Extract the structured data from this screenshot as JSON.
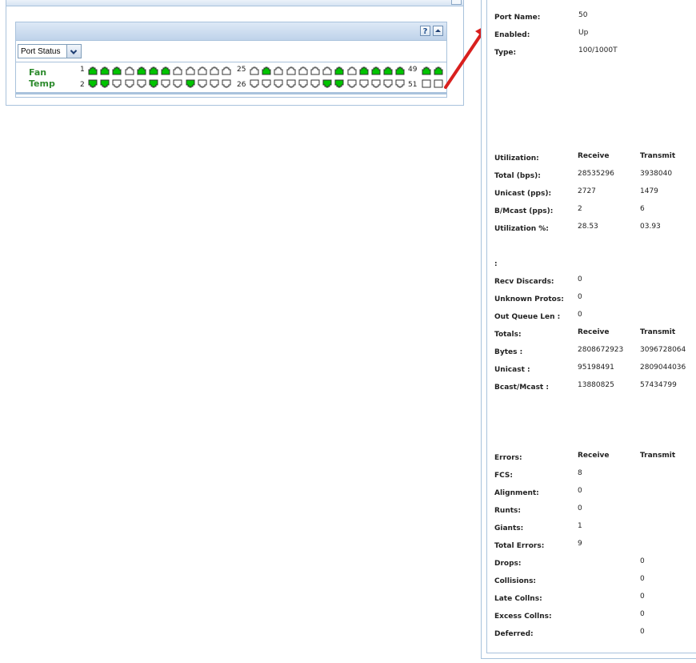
{
  "switch_panel": {
    "view_select": {
      "value": "Port Status"
    },
    "help_button": "?",
    "env_labels": {
      "fan": "Fan",
      "temp": "Temp"
    },
    "port_group_labels": {
      "top_1": "1",
      "bottom_1": "2",
      "top_2": "25",
      "bottom_2": "26",
      "top_3": "49",
      "bottom_3": "51"
    },
    "port_status": {
      "top_row": [
        "up",
        "up",
        "up",
        "down",
        "up",
        "up",
        "up",
        "down",
        "down",
        "down",
        "down",
        "down",
        "down",
        "up",
        "down",
        "down",
        "down",
        "down",
        "down",
        "up",
        "down",
        "up",
        "up",
        "up",
        "up"
      ],
      "bottom_row": [
        "up",
        "up",
        "down",
        "down",
        "down",
        "up",
        "down",
        "down",
        "up",
        "down",
        "down",
        "down",
        "down",
        "down",
        "down",
        "down",
        "down",
        "down",
        "up",
        "up",
        "down",
        "down",
        "down",
        "down",
        "down"
      ],
      "uplink_top": [
        "up",
        "up"
      ],
      "uplink_bottom": [
        "empty",
        "empty"
      ]
    },
    "colors": {
      "port_up": "#00c400",
      "port_down": "#ffffff",
      "env_text": "#2e8b2e"
    }
  },
  "arrow": {
    "color": "#d9201e"
  },
  "details": {
    "port_name": {
      "label": "Port Name:",
      "value": "50"
    },
    "enabled": {
      "label": "Enabled:",
      "value": "Up"
    },
    "type": {
      "label": "Type:",
      "value": "100/1000T"
    },
    "utilization_section": {
      "label": "Utilization:",
      "receive_header": "Receive",
      "transmit_header": "Transmit",
      "rows": [
        {
          "label": "Total (bps):",
          "receive": "28535296",
          "transmit": "3938040"
        },
        {
          "label": "Unicast (pps):",
          "receive": "2727",
          "transmit": "1479"
        },
        {
          "label": "B/Mcast (pps):",
          "receive": "2",
          "transmit": "6"
        },
        {
          "label": "Utilization %:",
          "receive": "28.53",
          "transmit": "03.93"
        }
      ]
    },
    "colon_label": ":",
    "misc_rows": [
      {
        "label": "Recv Discards:",
        "value": "0"
      },
      {
        "label": "Unknown Protos:",
        "value": "0"
      },
      {
        "label": "Out Queue Len :",
        "value": "0"
      }
    ],
    "totals_section": {
      "label": "Totals:",
      "receive_header": "Receive",
      "transmit_header": "Transmit",
      "rows": [
        {
          "label": "Bytes :",
          "receive": "2808672923",
          "transmit": "3096728064"
        },
        {
          "label": "Unicast :",
          "receive": "95198491",
          "transmit": "2809044036"
        },
        {
          "label": "Bcast/Mcast :",
          "receive": "13880825",
          "transmit": "57434799"
        }
      ]
    },
    "errors_section": {
      "label": "Errors:",
      "receive_header": "Receive",
      "transmit_header": "Transmit",
      "receive_rows": [
        {
          "label": "FCS:",
          "value": "8"
        },
        {
          "label": "Alignment:",
          "value": "0"
        },
        {
          "label": "Runts:",
          "value": "0"
        },
        {
          "label": "Giants:",
          "value": "1"
        },
        {
          "label": "Total Errors:",
          "value": "9"
        }
      ],
      "transmit_rows": [
        {
          "label": "Drops:",
          "value": "0"
        },
        {
          "label": "Collisions:",
          "value": "0"
        },
        {
          "label": "Late Collns:",
          "value": "0"
        },
        {
          "label": "Excess Collns:",
          "value": "0"
        },
        {
          "label": "Deferred:",
          "value": "0"
        }
      ]
    }
  }
}
